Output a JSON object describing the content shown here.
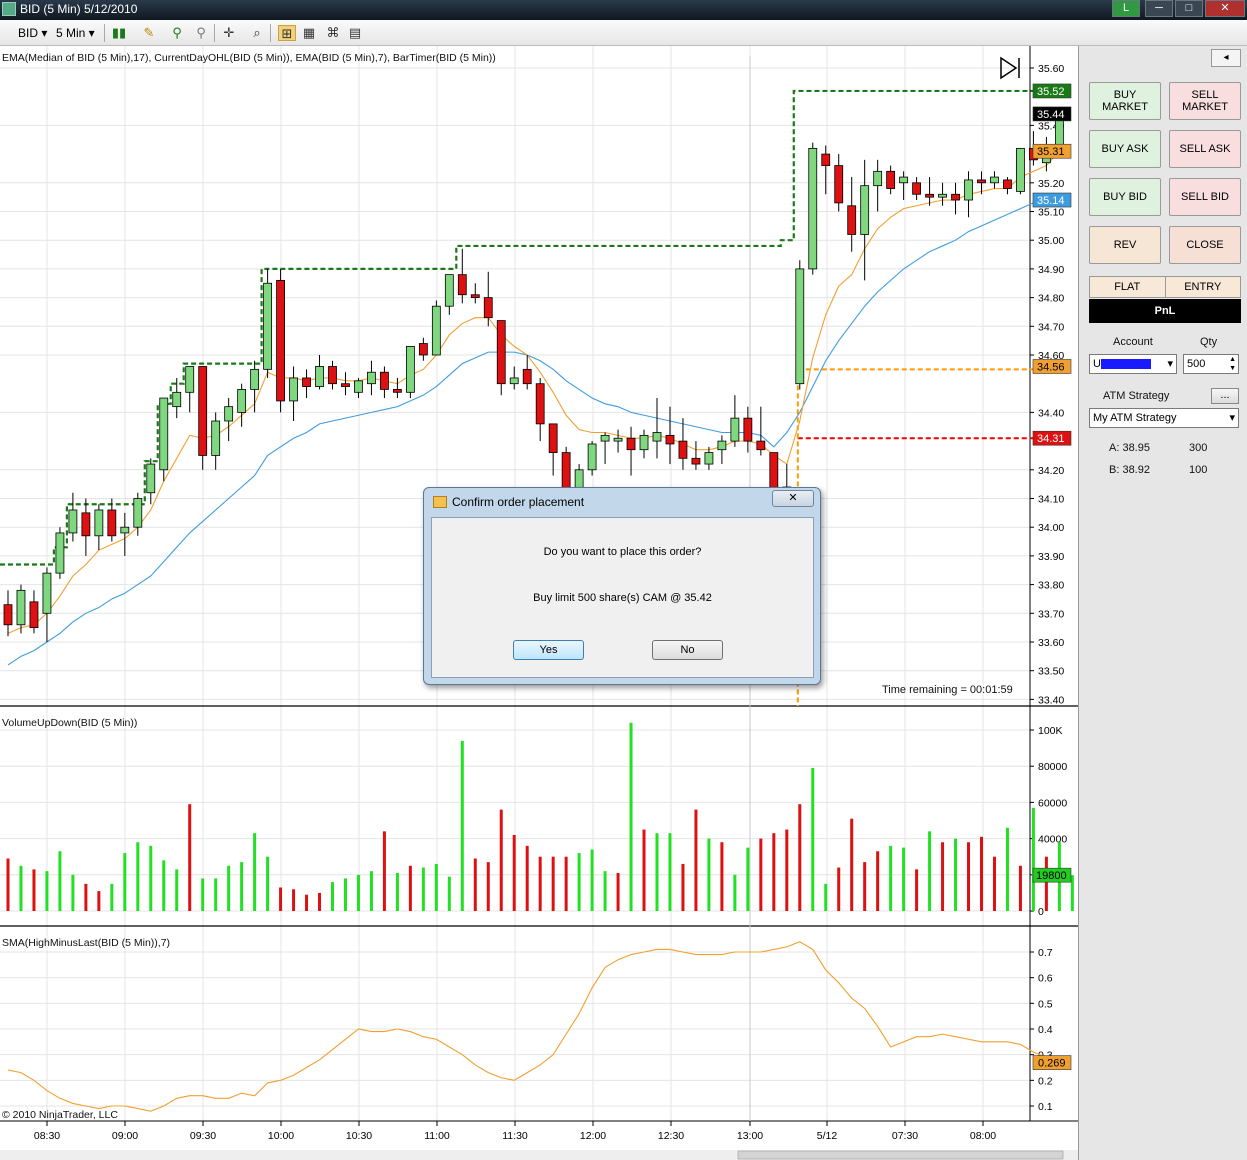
{
  "window": {
    "title": "BID (5 Min)  5/12/2010",
    "btn_l": "L",
    "btn_min": "─",
    "btn_max": "□",
    "btn_close": "✕"
  },
  "toolbar": {
    "instrument": "BID",
    "interval": "5 Min"
  },
  "chart": {
    "price_indicator_label": "EMA(Median of BID (5 Min),17), CurrentDayOHL(BID (5 Min)), EMA(BID (5 Min),7), BarTimer(BID (5 Min))",
    "volume_indicator_label": "VolumeUpDown(BID (5 Min))",
    "sma_indicator_label": "SMA(HighMinusLast(BID (5 Min)),7)",
    "time_remaining": "Time remaining = 00:01:59",
    "copyright": "© 2010 NinjaTrader, LLC",
    "colors": {
      "up": "#7fd87f",
      "down": "#dd1111",
      "ema17": "#3d9ce0",
      "ema7": "#f0a030",
      "ohl": "#1a7a1a",
      "grid": "#e4e4e4"
    }
  },
  "chart_data": [
    {
      "type": "candlestick",
      "ylim": [
        33.4,
        35.6
      ],
      "y_ticks": [
        "35.60",
        "35.40",
        "35.20",
        "35.10",
        "35.00",
        "34.90",
        "34.80",
        "34.70",
        "34.60",
        "34.40",
        "34.20",
        "34.10",
        "34.00",
        "33.90",
        "33.80",
        "33.70",
        "33.60",
        "33.50",
        "33.40"
      ],
      "price_tags": [
        {
          "value": "35.52",
          "color": "#1a7a1a",
          "text_color": "#ffffff"
        },
        {
          "value": "35.44",
          "color": "#000000",
          "text_color": "#ffffff"
        },
        {
          "value": "35.31",
          "color": "#f0a030",
          "text_color": "#000000"
        },
        {
          "value": "35.14",
          "color": "#3d9ce0",
          "text_color": "#ffffff"
        },
        {
          "value": "34.56",
          "color": "#f0a030",
          "text_color": "#000000"
        },
        {
          "value": "34.31",
          "color": "#dd1111",
          "text_color": "#ffffff"
        }
      ],
      "ohlc": [
        [
          33.73,
          33.78,
          33.62,
          33.66
        ],
        [
          33.66,
          33.8,
          33.63,
          33.78
        ],
        [
          33.74,
          33.78,
          33.63,
          33.65
        ],
        [
          33.7,
          33.86,
          33.6,
          33.84
        ],
        [
          33.84,
          34.0,
          33.82,
          33.98
        ],
        [
          33.98,
          34.12,
          33.95,
          34.06
        ],
        [
          34.05,
          34.1,
          33.9,
          33.97
        ],
        [
          33.97,
          34.08,
          33.92,
          34.06
        ],
        [
          34.06,
          34.1,
          33.95,
          33.97
        ],
        [
          33.98,
          34.05,
          33.9,
          34.0
        ],
        [
          34.0,
          34.12,
          33.97,
          34.1
        ],
        [
          34.12,
          34.24,
          34.08,
          34.22
        ],
        [
          34.2,
          34.45,
          34.16,
          34.45
        ],
        [
          34.42,
          34.52,
          34.38,
          34.47
        ],
        [
          34.47,
          34.56,
          34.4,
          34.56
        ],
        [
          34.56,
          34.56,
          34.2,
          34.25
        ],
        [
          34.25,
          34.4,
          34.2,
          34.37
        ],
        [
          34.37,
          34.45,
          34.3,
          34.42
        ],
        [
          34.4,
          34.5,
          34.35,
          34.48
        ],
        [
          34.48,
          34.58,
          34.4,
          34.55
        ],
        [
          34.55,
          34.9,
          34.52,
          34.85
        ],
        [
          34.86,
          34.9,
          34.4,
          34.44
        ],
        [
          34.44,
          34.56,
          34.37,
          34.52
        ],
        [
          34.52,
          34.55,
          34.45,
          34.49
        ],
        [
          34.49,
          34.6,
          34.48,
          34.56
        ],
        [
          34.56,
          34.58,
          34.48,
          34.5
        ],
        [
          34.5,
          34.54,
          34.46,
          34.49
        ],
        [
          34.47,
          34.52,
          34.45,
          34.51
        ],
        [
          34.5,
          34.58,
          34.46,
          34.54
        ],
        [
          34.54,
          34.56,
          34.45,
          34.48
        ],
        [
          34.48,
          34.52,
          34.45,
          34.47
        ],
        [
          34.47,
          34.63,
          34.45,
          34.63
        ],
        [
          34.64,
          34.66,
          34.58,
          34.6
        ],
        [
          34.6,
          34.79,
          34.6,
          34.77
        ],
        [
          34.77,
          34.88,
          34.74,
          34.88
        ],
        [
          34.88,
          34.97,
          34.78,
          34.81
        ],
        [
          34.81,
          34.85,
          34.78,
          34.8
        ],
        [
          34.8,
          34.89,
          34.7,
          34.73
        ],
        [
          34.72,
          34.72,
          34.46,
          34.5
        ],
        [
          34.5,
          34.56,
          34.48,
          34.52
        ],
        [
          34.55,
          34.6,
          34.48,
          34.5
        ],
        [
          34.5,
          34.52,
          34.3,
          34.36
        ],
        [
          34.36,
          34.36,
          34.18,
          34.26
        ],
        [
          34.26,
          34.28,
          34.06,
          34.12
        ],
        [
          34.12,
          34.22,
          34.1,
          34.2
        ],
        [
          34.2,
          34.3,
          34.18,
          34.29
        ],
        [
          34.3,
          34.33,
          34.22,
          34.32
        ],
        [
          34.3,
          34.34,
          34.26,
          34.31
        ],
        [
          34.31,
          34.35,
          34.18,
          34.27
        ],
        [
          34.27,
          34.34,
          34.24,
          34.32
        ],
        [
          34.3,
          34.45,
          34.24,
          34.33
        ],
        [
          34.32,
          34.42,
          34.22,
          34.29
        ],
        [
          34.3,
          34.38,
          34.2,
          34.24
        ],
        [
          34.24,
          34.3,
          34.2,
          34.22
        ],
        [
          34.22,
          34.28,
          34.2,
          34.26
        ],
        [
          34.27,
          34.32,
          34.22,
          34.3
        ],
        [
          34.3,
          34.46,
          34.28,
          34.38
        ],
        [
          34.38,
          34.42,
          34.26,
          34.3
        ],
        [
          34.3,
          34.42,
          34.25,
          34.27
        ],
        [
          34.26,
          34.26,
          34.1,
          34.11
        ],
        [
          34.1,
          34.22,
          34.0,
          34.14
        ],
        [
          34.5,
          34.93,
          34.48,
          34.9
        ],
        [
          34.9,
          35.34,
          34.88,
          35.32
        ],
        [
          35.3,
          35.33,
          35.16,
          35.26
        ],
        [
          35.26,
          35.3,
          35.1,
          35.13
        ],
        [
          35.12,
          35.22,
          34.96,
          35.02
        ],
        [
          35.02,
          35.28,
          34.86,
          35.19
        ],
        [
          35.19,
          35.28,
          35.1,
          35.24
        ],
        [
          35.24,
          35.26,
          35.16,
          35.18
        ],
        [
          35.2,
          35.24,
          35.14,
          35.22
        ],
        [
          35.2,
          35.22,
          35.14,
          35.16
        ],
        [
          35.16,
          35.22,
          35.12,
          35.15
        ],
        [
          35.15,
          35.2,
          35.12,
          35.16
        ],
        [
          35.16,
          35.2,
          35.09,
          35.14
        ],
        [
          35.14,
          35.24,
          35.08,
          35.21
        ],
        [
          35.21,
          35.24,
          35.16,
          35.2
        ],
        [
          35.2,
          35.24,
          35.18,
          35.22
        ],
        [
          35.21,
          35.22,
          35.16,
          35.18
        ],
        [
          35.17,
          35.31,
          35.16,
          35.32
        ],
        [
          35.32,
          35.38,
          35.26,
          35.28
        ],
        [
          35.27,
          35.36,
          35.24,
          35.33
        ],
        [
          35.33,
          35.46,
          35.29,
          35.44
        ]
      ],
      "ema17": [
        33.52,
        33.55,
        33.57,
        33.6,
        33.63,
        33.67,
        33.7,
        33.72,
        33.75,
        33.77,
        33.8,
        33.83,
        33.88,
        33.93,
        33.98,
        34.02,
        34.06,
        34.1,
        34.14,
        34.18,
        34.25,
        34.28,
        34.31,
        34.33,
        34.36,
        34.37,
        34.38,
        34.39,
        34.4,
        34.41,
        34.42,
        34.44,
        34.46,
        34.49,
        34.53,
        34.57,
        34.59,
        34.61,
        34.61,
        34.61,
        34.6,
        34.58,
        34.55,
        34.51,
        34.48,
        34.45,
        34.43,
        34.42,
        34.4,
        34.39,
        34.38,
        34.37,
        34.36,
        34.35,
        34.34,
        34.33,
        34.33,
        34.33,
        34.32,
        34.28,
        34.33,
        34.4,
        34.49,
        34.58,
        34.65,
        34.71,
        34.77,
        34.82,
        34.86,
        34.9,
        34.93,
        34.96,
        34.98,
        35.0,
        35.03,
        35.05,
        35.07,
        35.09,
        35.11,
        35.13,
        35.14
      ],
      "ema7": [
        33.63,
        33.65,
        33.66,
        33.7,
        33.76,
        33.83,
        33.87,
        33.92,
        33.94,
        33.96,
        34.0,
        34.06,
        34.16,
        34.24,
        34.32,
        34.31,
        34.32,
        34.35,
        34.39,
        34.43,
        34.54,
        34.52,
        34.52,
        34.51,
        34.52,
        34.52,
        34.51,
        34.51,
        34.52,
        34.51,
        34.5,
        34.53,
        34.55,
        34.6,
        34.67,
        34.71,
        34.73,
        34.73,
        34.67,
        34.63,
        34.6,
        34.54,
        34.47,
        34.39,
        34.34,
        34.33,
        34.33,
        34.32,
        34.31,
        34.31,
        34.32,
        34.31,
        34.29,
        34.27,
        34.27,
        34.28,
        34.3,
        34.3,
        34.29,
        34.25,
        34.22,
        34.37,
        34.59,
        34.74,
        34.84,
        34.88,
        34.97,
        35.04,
        35.08,
        35.11,
        35.12,
        35.13,
        35.14,
        35.14,
        35.16,
        35.17,
        35.18,
        35.18,
        35.22,
        35.24,
        35.26,
        35.31
      ],
      "ohl_high_steps": [
        [
          0,
          33.87
        ],
        [
          4,
          33.93
        ],
        [
          5,
          34.08
        ],
        [
          9,
          34.08
        ],
        [
          11,
          34.23
        ],
        [
          12,
          34.43
        ],
        [
          13,
          34.5
        ],
        [
          14,
          34.57
        ],
        [
          20,
          34.9
        ],
        [
          35,
          34.98
        ],
        [
          59,
          34.98
        ],
        [
          60,
          35.0
        ],
        [
          61,
          35.52
        ],
        [
          81,
          35.52
        ]
      ],
      "ohl_low": 34.31,
      "ohl_open": 34.55
    },
    {
      "type": "bar",
      "name": "VolumeUpDown",
      "ylim": [
        0,
        100000
      ],
      "y_ticks": [
        "100K",
        "80000",
        "60000",
        "40000",
        "20000",
        "0"
      ],
      "last_value": "19800",
      "values": [
        29000,
        25000,
        23000,
        22000,
        33000,
        20000,
        15000,
        11000,
        15000,
        32000,
        38000,
        36000,
        28000,
        23000,
        59000,
        18000,
        18000,
        25000,
        27000,
        43000,
        30000,
        13000,
        12000,
        9000,
        10000,
        16000,
        18000,
        20000,
        22000,
        44000,
        21000,
        25000,
        24000,
        26000,
        19000,
        94000,
        29000,
        27000,
        56000,
        42000,
        36000,
        30000,
        30000,
        30000,
        32000,
        34000,
        22000,
        21000,
        104000,
        45000,
        43000,
        43000,
        26000,
        56000,
        40000,
        38000,
        20000,
        35000,
        40000,
        43000,
        45000,
        59000,
        79000,
        15000,
        24000,
        51000,
        27000,
        33000,
        36000,
        35000,
        23000,
        44000,
        38000,
        40000,
        38000,
        41000,
        30000,
        46000,
        25000,
        57000,
        30000,
        38000,
        19800
      ],
      "up": [
        false,
        true,
        false,
        true,
        true,
        true,
        false,
        false,
        true,
        true,
        true,
        true,
        true,
        true,
        false,
        true,
        true,
        true,
        true,
        true,
        true,
        false,
        false,
        false,
        false,
        true,
        true,
        true,
        true,
        false,
        true,
        false,
        true,
        true,
        true,
        true,
        false,
        false,
        false,
        false,
        false,
        false,
        false,
        false,
        true,
        true,
        true,
        false,
        true,
        false,
        true,
        true,
        false,
        false,
        true,
        false,
        true,
        true,
        false,
        false,
        false,
        false,
        true,
        true,
        false,
        false,
        false,
        false,
        true,
        true,
        false,
        true,
        false,
        true,
        false,
        false,
        false,
        true,
        false,
        true,
        false,
        true,
        true
      ]
    },
    {
      "type": "line",
      "name": "SMA(HighMinusLast)",
      "ylim": [
        0.05,
        0.75
      ],
      "y_ticks": [
        "0.7",
        "0.6",
        "0.5",
        "0.4",
        "0.3",
        "0.2",
        "0.1"
      ],
      "last_value": "0.269",
      "values": [
        0.24,
        0.23,
        0.2,
        0.16,
        0.13,
        0.11,
        0.1,
        0.09,
        0.1,
        0.1,
        0.09,
        0.08,
        0.1,
        0.13,
        0.14,
        0.14,
        0.13,
        0.13,
        0.15,
        0.14,
        0.19,
        0.2,
        0.22,
        0.25,
        0.28,
        0.32,
        0.36,
        0.4,
        0.39,
        0.39,
        0.4,
        0.39,
        0.37,
        0.36,
        0.33,
        0.3,
        0.26,
        0.23,
        0.21,
        0.2,
        0.23,
        0.26,
        0.3,
        0.38,
        0.46,
        0.56,
        0.64,
        0.67,
        0.69,
        0.7,
        0.71,
        0.71,
        0.7,
        0.69,
        0.69,
        0.69,
        0.7,
        0.7,
        0.7,
        0.71,
        0.72,
        0.74,
        0.71,
        0.63,
        0.58,
        0.52,
        0.48,
        0.41,
        0.33,
        0.35,
        0.37,
        0.37,
        0.38,
        0.37,
        0.36,
        0.35,
        0.35,
        0.35,
        0.34,
        0.31,
        0.29,
        0.27
      ]
    }
  ],
  "time_axis": [
    "08:30",
    "09:00",
    "09:30",
    "10:00",
    "10:30",
    "11:00",
    "11:30",
    "12:00",
    "12:30",
    "13:00",
    "5/12",
    "07:30",
    "08:00"
  ],
  "panel": {
    "buy_market": "BUY\nMARKET",
    "sell_market": "SELL\nMARKET",
    "buy_ask": "BUY ASK",
    "sell_ask": "SELL ASK",
    "buy_bid": "BUY BID",
    "sell_bid": "SELL BID",
    "rev": "REV",
    "close": "CLOSE",
    "flat": "FLAT",
    "entry": "ENTRY",
    "pnl": "PnL",
    "account_label": "Account",
    "account_value": "U",
    "qty_label": "Qty",
    "qty_value": "500",
    "atm_label": "ATM Strategy",
    "atm_btn": "...",
    "atm_value": "My ATM Strategy",
    "ask_label": "A: 38.95",
    "ask_size": "300",
    "bid_label": "B: 38.92",
    "bid_size": "100"
  },
  "dialog": {
    "title": "Confirm order placement",
    "close": "✕",
    "question": "Do you want to place this order?",
    "detail": "Buy limit 500 share(s) CAM @ 35.42",
    "yes": "Yes",
    "no": "No"
  }
}
